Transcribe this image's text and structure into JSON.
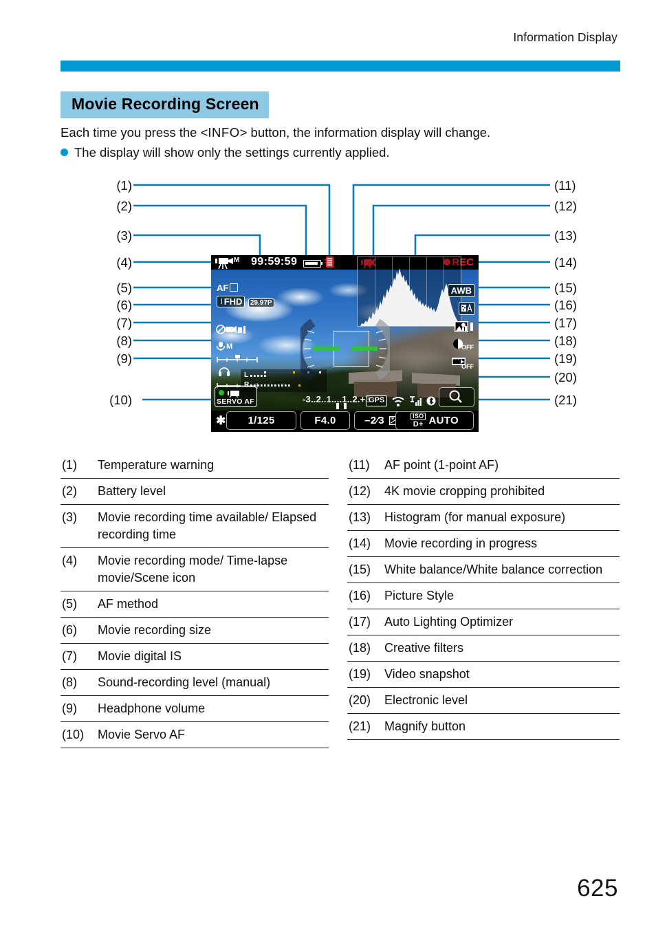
{
  "header": {
    "running_head": "Information Display",
    "accent_color": "#0099d2"
  },
  "section": {
    "heading": "Movie Recording Screen",
    "heading_bg": "#8dc8e4"
  },
  "intro": {
    "line1_before": "Each time you press the <",
    "line1_button": "INFO",
    "line1_after": "> button, the information display will change.",
    "line2": "The display will show only the settings currently applied."
  },
  "callouts": {
    "left": [
      "(1)",
      "(2)",
      "(3)",
      "(4)",
      "(5)",
      "(6)",
      "(7)",
      "(8)",
      "(9)",
      "(10)"
    ],
    "right": [
      "(11)",
      "(12)",
      "(13)",
      "(14)",
      "(15)",
      "(16)",
      "(17)",
      "(18)",
      "(19)",
      "(20)",
      "(21)"
    ]
  },
  "camera_screen": {
    "top_bar": {
      "recording_mode_icon": "movie-mode-M-icon",
      "rec_time": "99:59:59",
      "battery_icon": "battery-full-icon",
      "temperature_warning_icon": "temperature-warning-icon",
      "crop_prohibited_icon": "4k-crop-prohibited-icon",
      "rec_indicator": "REC"
    },
    "left_column": {
      "af_method": "AF",
      "af_method_icon": "af-1point-icon",
      "movie_size": "FHD",
      "movie_frame_rate": "29.97P",
      "digital_is_icon": "movie-digital-is-off-icon",
      "sound_level_label": "M",
      "sound_level_icon": "microphone-manual-icon",
      "headphone_icon": "headphone-volume-icon"
    },
    "right_column": {
      "white_balance": "AWB",
      "picture_style": "A",
      "picture_style_icon": "picture-style-auto-icon",
      "auto_lighting_optimizer_icon": "auto-lighting-optimizer-icon",
      "creative_filter": "OFF",
      "creative_filter_icon": "creative-filter-icon",
      "video_snapshot": "OFF",
      "video_snapshot_icon": "video-snapshot-icon"
    },
    "audio_meter": {
      "left_label": "L",
      "right_label": "R"
    },
    "servo_af": {
      "label": "SERVO AF",
      "indicator_color": "#22c024"
    },
    "exposure_scale": "-3..2..1....1..2.+3",
    "status_icons": {
      "gps": "GPS",
      "wifi": "wifi-icon",
      "signal": "signal-strength-icon",
      "bluetooth": "bluetooth-icon"
    },
    "magnify_icon": "magnify-button-icon",
    "bottom_bar": {
      "ae_lock_icon": "ae-lock-asterisk-icon",
      "shutter_speed": "1/125",
      "aperture": "F4.0",
      "exposure_comp": "–2⁄3",
      "exposure_comp_icon": "exposure-compensation-icon",
      "iso_label": "ISO",
      "highlight_tone_label": "D+",
      "iso_value": "AUTO"
    }
  },
  "legend": {
    "left": [
      {
        "n": "(1)",
        "t": "Temperature warning"
      },
      {
        "n": "(2)",
        "t": "Battery level"
      },
      {
        "n": "(3)",
        "t": "Movie recording time available/ Elapsed recording time"
      },
      {
        "n": "(4)",
        "t": "Movie recording mode/ Time-lapse movie/Scene icon"
      },
      {
        "n": "(5)",
        "t": "AF method"
      },
      {
        "n": "(6)",
        "t": "Movie recording size"
      },
      {
        "n": "(7)",
        "t": "Movie digital IS"
      },
      {
        "n": "(8)",
        "t": "Sound-recording level (manual)"
      },
      {
        "n": "(9)",
        "t": "Headphone volume"
      },
      {
        "n": "(10)",
        "t": "Movie Servo AF"
      }
    ],
    "right": [
      {
        "n": "(11)",
        "t": "AF point (1-point AF)"
      },
      {
        "n": "(12)",
        "t": "4K movie cropping prohibited"
      },
      {
        "n": "(13)",
        "t": "Histogram (for manual exposure)"
      },
      {
        "n": "(14)",
        "t": "Movie recording in progress"
      },
      {
        "n": "(15)",
        "t": "White balance/White balance correction"
      },
      {
        "n": "(16)",
        "t": "Picture Style"
      },
      {
        "n": "(17)",
        "t": "Auto Lighting Optimizer"
      },
      {
        "n": "(18)",
        "t": "Creative filters"
      },
      {
        "n": "(19)",
        "t": "Video snapshot"
      },
      {
        "n": "(20)",
        "t": "Electronic level"
      },
      {
        "n": "(21)",
        "t": "Magnify button"
      }
    ]
  },
  "page_number": "625"
}
